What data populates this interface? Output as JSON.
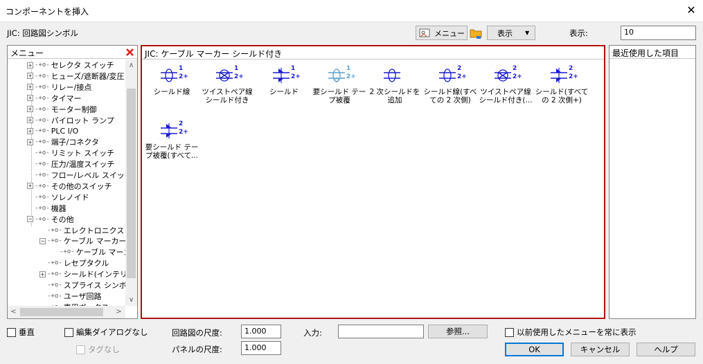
{
  "window": {
    "title": "コンポーネントを挿入",
    "close_glyph": "✕"
  },
  "header": {
    "library_label": "JIC: 回路図シンボル",
    "menu_button": "メニュー",
    "display_button": "表示",
    "display_label": "表示:",
    "display_value": "10"
  },
  "left_panel": {
    "title": "メニュー",
    "close_color": "#e02020",
    "items": [
      {
        "label": "セレクタ スイッチ",
        "expander": "+",
        "level": 0
      },
      {
        "label": "ヒューズ/遮断器/変圧",
        "expander": "+",
        "level": 0
      },
      {
        "label": "リレー/接点",
        "expander": "+",
        "level": 0
      },
      {
        "label": "タイマー",
        "expander": "+",
        "level": 0
      },
      {
        "label": "モーター制御",
        "expander": "+",
        "level": 0
      },
      {
        "label": "パイロット ランプ",
        "expander": "+",
        "level": 0
      },
      {
        "label": "PLC I/O",
        "expander": "+",
        "level": 0
      },
      {
        "label": "端子/コネクタ",
        "expander": "+",
        "level": 0
      },
      {
        "label": "リミット スイッチ",
        "expander": "",
        "level": 0
      },
      {
        "label": "圧力/温度スイッチ",
        "expander": "",
        "level": 0
      },
      {
        "label": "フロー/レベル スイッチ",
        "expander": "",
        "level": 0
      },
      {
        "label": "その他のスイッチ",
        "expander": "+",
        "level": 0
      },
      {
        "label": "ソレノイド",
        "expander": "",
        "level": 0
      },
      {
        "label": "機器",
        "expander": "",
        "level": 0
      },
      {
        "label": "その他",
        "expander": "−",
        "level": 0
      },
      {
        "label": "エレクトロニクス",
        "expander": "",
        "level": 1
      },
      {
        "label": "ケーブル マーカー",
        "expander": "−",
        "level": 1
      },
      {
        "label": "ケーブル マーカ",
        "expander": "",
        "level": 2
      },
      {
        "label": "レセプタクル",
        "expander": "",
        "level": 1
      },
      {
        "label": "シールド(インテリジ",
        "expander": "+",
        "level": 1
      },
      {
        "label": "スプライス シンボル",
        "expander": "",
        "level": 1
      },
      {
        "label": "ユーザ回路",
        "expander": "",
        "level": 1
      },
      {
        "label": "専用ボックス",
        "expander": "",
        "level": 1
      }
    ]
  },
  "center_panel": {
    "title": "JIC: ケーブル マーカー シールド付き",
    "border_color": "#b01010",
    "symbol_color": "#1a1ad0",
    "tiles": [
      {
        "label": "シールド線",
        "icon": "shielded-wire-icon",
        "t1": "1",
        "t2": "2+"
      },
      {
        "label": "ツイストペア線 シールド付き",
        "icon": "twisted-pair-shield-icon",
        "t1": "1",
        "t2": "2+"
      },
      {
        "label": "シールド",
        "icon": "shield-icon",
        "t1": "1",
        "t2": "2+"
      },
      {
        "label": "要シールド テープ被覆",
        "icon": "shield-tape-icon",
        "t1": "1",
        "t2": "2+"
      },
      {
        "label": "2 次シールドを追加",
        "icon": "add-secondary-shield-icon",
        "t1": "",
        "t2": ""
      },
      {
        "label": "シールド線(すべての 2 次側)",
        "icon": "shielded-wire-all-icon",
        "t1": "2",
        "t2": "2+"
      },
      {
        "label": "ツイストペア線 シールド付き(...",
        "icon": "twisted-pair-shield-all-icon",
        "t1": "2",
        "t2": "2+"
      },
      {
        "label": "シールド(すべての 2 次側+)",
        "icon": "shield-all-icon",
        "t1": "2",
        "t2": "2+"
      },
      {
        "label": "要シールド テープ被覆(すべて...",
        "icon": "shield-tape-all-icon",
        "t1": "2",
        "t2": "2+"
      }
    ]
  },
  "right_panel": {
    "title": "最近使用した項目"
  },
  "footer": {
    "vertical_label": "垂直",
    "edit_dialog_label": "編集ダイアログなし",
    "no_tag_label": "タグなし",
    "circuit_scale_label": "回路図の尺度:",
    "circuit_scale_value": "1.000",
    "panel_scale_label": "パネルの尺度:",
    "panel_scale_value": "1.000",
    "input_label": "入力:",
    "input_value": "",
    "browse_button": "参照...",
    "always_show_label": "以前使用したメニューを常に表示",
    "ok_button": "OK",
    "cancel_button": "キャンセル",
    "help_button": "ヘルプ"
  }
}
